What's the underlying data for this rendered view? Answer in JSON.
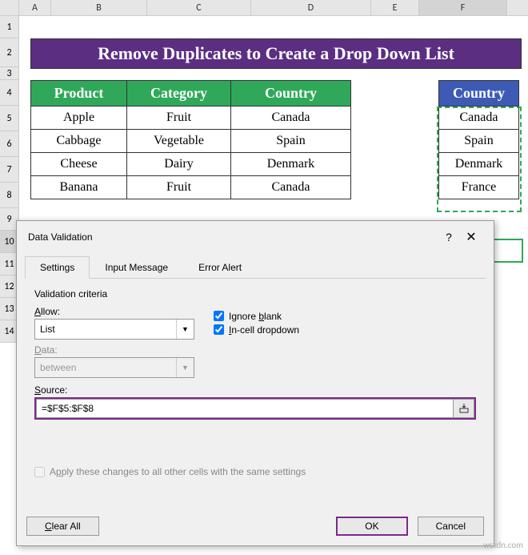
{
  "columns": [
    "A",
    "B",
    "C",
    "D",
    "E",
    "F"
  ],
  "rows": [
    "1",
    "2",
    "3",
    "4",
    "5",
    "6",
    "7",
    "8",
    "9",
    "10",
    "11",
    "12",
    "13",
    "14"
  ],
  "title": "Remove Duplicates to Create a Drop Down List",
  "table1": {
    "headers": [
      "Product",
      "Category",
      "Country"
    ],
    "rows": [
      [
        "Apple",
        "Fruit",
        "Canada"
      ],
      [
        "Cabbage",
        "Vegetable",
        "Spain"
      ],
      [
        "Cheese",
        "Dairy",
        "Denmark"
      ],
      [
        "Banana",
        "Fruit",
        "Canada"
      ]
    ]
  },
  "table2": {
    "header": "Country",
    "rows": [
      "Canada",
      "Spain",
      "Denmark",
      "France"
    ]
  },
  "dialog": {
    "title": "Data Validation",
    "tabs": [
      "Settings",
      "Input Message",
      "Error Alert"
    ],
    "criteria": "Validation criteria",
    "allow_label": "Allow:",
    "allow_value": "List",
    "data_label": "Data:",
    "data_value": "between",
    "ignore_blank": "Ignore blank",
    "incell": "In-cell dropdown",
    "source_label": "Source:",
    "source_value": "=$F$5:$F$8",
    "apply": "Apply these changes to all other cells with the same settings",
    "clear": "Clear All",
    "ok": "OK",
    "cancel": "Cancel"
  },
  "watermark": "wsxdn.com"
}
